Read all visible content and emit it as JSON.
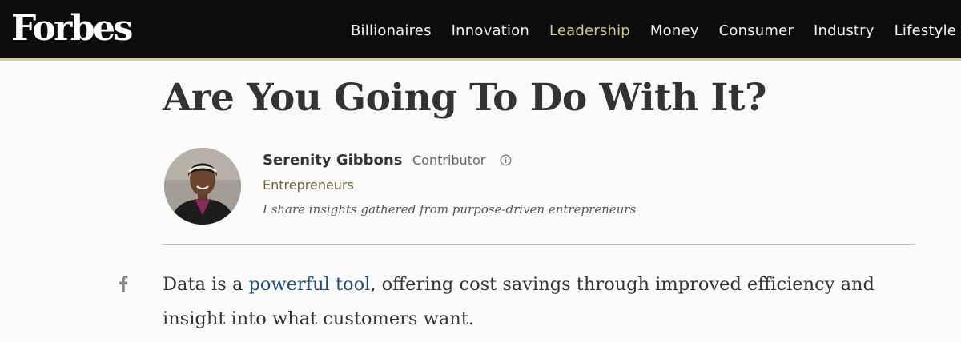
{
  "header": {
    "logo": "Forbes",
    "nav": [
      {
        "label": "Billionaires",
        "active": false
      },
      {
        "label": "Innovation",
        "active": false
      },
      {
        "label": "Leadership",
        "active": true
      },
      {
        "label": "Money",
        "active": false
      },
      {
        "label": "Consumer",
        "active": false
      },
      {
        "label": "Industry",
        "active": false
      },
      {
        "label": "Lifestyle",
        "active": false
      }
    ],
    "active_color": "#d5c68c"
  },
  "article": {
    "title_cut": ",",
    "title_line": "Are You Going To Do With It?",
    "author": {
      "name": "Serenity Gibbons",
      "role": "Contributor",
      "role_icon": "info-icon",
      "channel": "Entrepreneurs",
      "bio": "I share insights gathered from purpose-driven entrepreneurs"
    },
    "share_icon": "facebook-icon",
    "body": {
      "before": "Data is a ",
      "link": "powerful tool",
      "after_line1": ", offering cost savings through improved efficiency and",
      "line2": "insight into what customers want."
    }
  },
  "colors": {
    "header_bg": "#0d0d0d",
    "header_border": "#d8cfa8",
    "channel": "#6f6533",
    "link": "#1f4e79"
  }
}
